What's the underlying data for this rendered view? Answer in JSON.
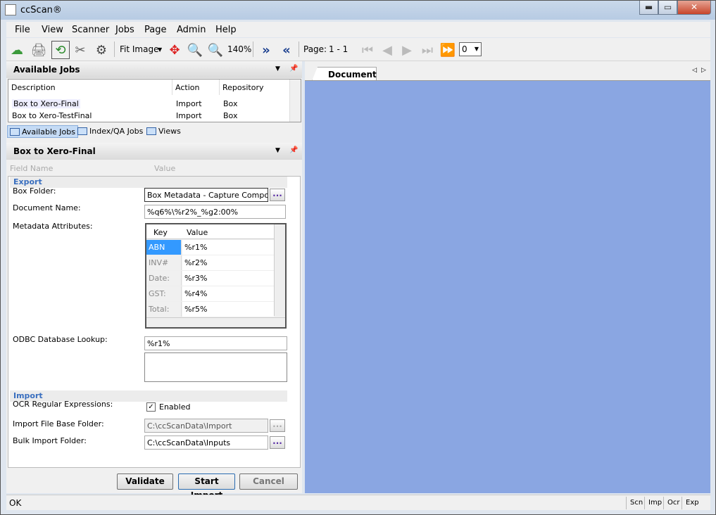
{
  "app": {
    "title": "ccScan®"
  },
  "window": {
    "minimize": "▬",
    "maximize": "▭",
    "close": "✕"
  },
  "menu": [
    "File",
    "View",
    "Scanner",
    "Jobs",
    "Page",
    "Admin",
    "Help"
  ],
  "toolbar": {
    "fit": "Fit Image",
    "zoom": "140%",
    "page_label": "Page:",
    "page_value": "1 - 1",
    "page_select": "0"
  },
  "jobs_panel": {
    "title": "Available Jobs",
    "columns": [
      "Description",
      "Action",
      "Repository"
    ],
    "rows": [
      {
        "description": "Box to Xero-Final",
        "action": "Import",
        "repository": "Box"
      },
      {
        "description": "Box to Xero-TestFinal",
        "action": "Import",
        "repository": "Box"
      }
    ],
    "tabs": [
      "Available Jobs",
      "Index/QA Jobs",
      "Views"
    ]
  },
  "job_panel": {
    "title": "Box to Xero-Final",
    "col_field": "Field Name",
    "col_value": "Value",
    "export_section": "Export",
    "box_folder_label": "Box Folder:",
    "box_folder_value": "Box Metadata - Capture Components",
    "doc_name_label": "Document Name:",
    "doc_name_value": "%q6%\\%r2%_%g2:00%",
    "metadata_label": "Metadata Attributes:",
    "meta_key_header": "Key",
    "meta_value_header": "Value",
    "meta_rows": [
      {
        "key": "ABN",
        "value": "%r1%"
      },
      {
        "key": "INV#",
        "value": "%r2%"
      },
      {
        "key": "Date:",
        "value": "%r3%"
      },
      {
        "key": "GST:",
        "value": "%r4%"
      },
      {
        "key": "Total:",
        "value": "%r5%"
      }
    ],
    "odbc_label": "ODBC Database Lookup:",
    "odbc_value": "%r1%",
    "import_section": "Import",
    "ocr_label": "OCR Regular Expressions:",
    "ocr_checkbox": "Enabled",
    "import_base_label": "Import File Base Folder:",
    "import_base_value": "C:\\ccScanData\\Import",
    "bulk_label": "Bulk Import Folder:",
    "bulk_value": "C:\\ccScanData\\Inputs",
    "ellipsis": "...",
    "buttons": {
      "validate": "Validate",
      "start": "Start Import",
      "cancel": "Cancel"
    }
  },
  "document_tab": "Document",
  "status": {
    "text": "OK",
    "indicators": [
      "Scn",
      "Imp",
      "Ocr",
      "Exp"
    ]
  }
}
